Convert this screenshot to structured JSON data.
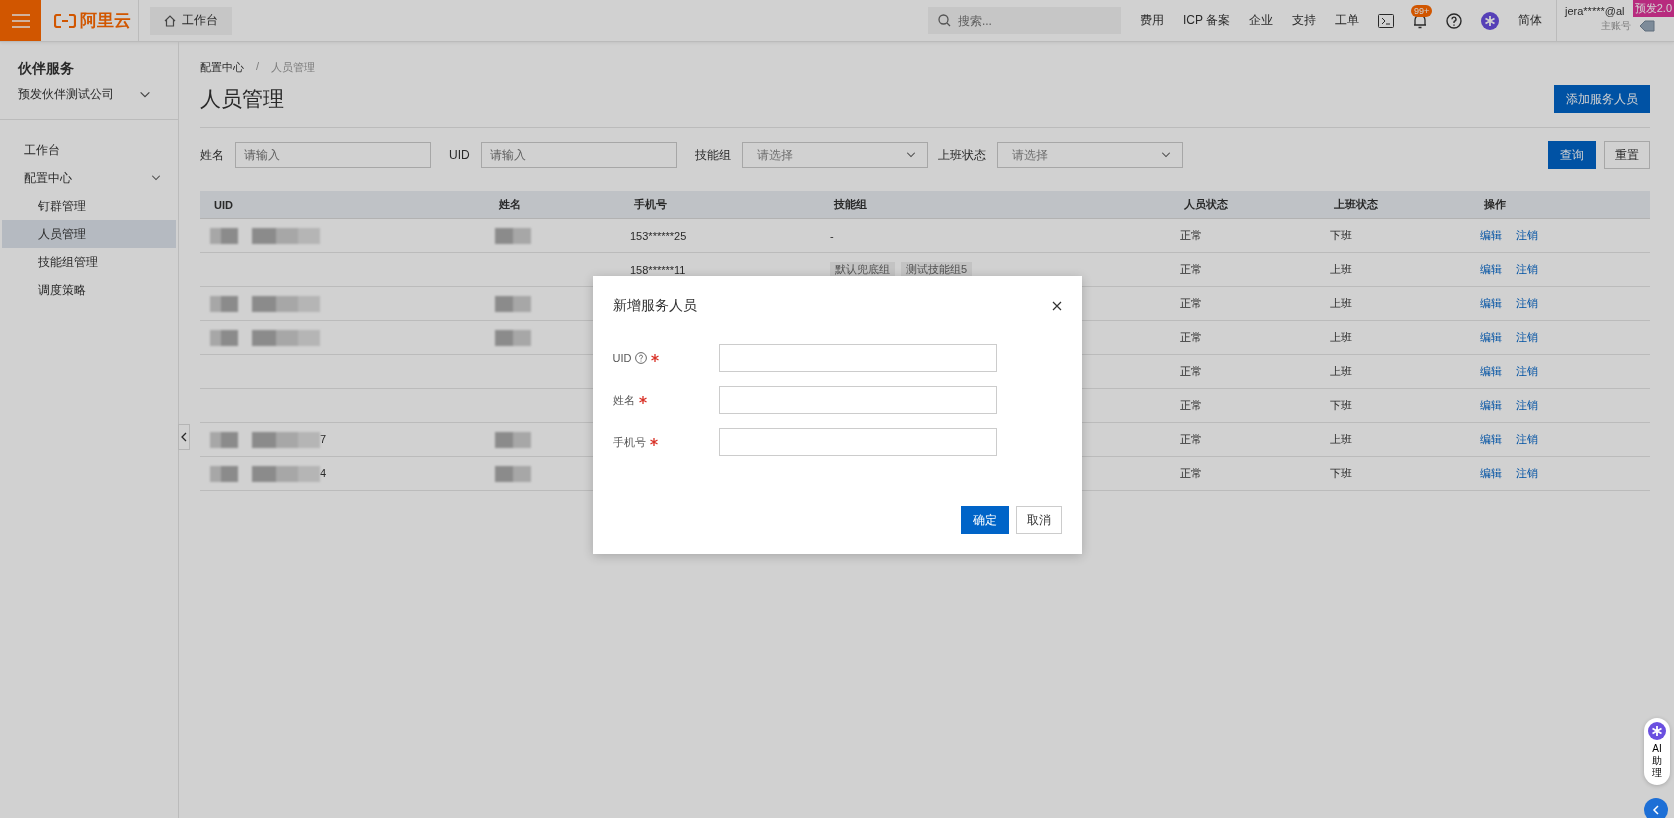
{
  "topbar": {
    "brand": "阿里云",
    "home_tab": "工作台",
    "search": {
      "placeholder": "搜索..."
    },
    "links": [
      "费用",
      "ICP 备案",
      "企业",
      "支持",
      "工单"
    ],
    "notification_badge": "99+",
    "language": "简体",
    "account": {
      "name": "jera*****@al",
      "role": "主账号"
    },
    "env_badge": "预发2.0"
  },
  "sidebar": {
    "title": "伙伴服务",
    "company": "预发伙伴测试公司",
    "items": [
      {
        "label": "工作台",
        "selected": false
      },
      {
        "label": "配置中心",
        "selected": false,
        "expanded": true,
        "children": [
          {
            "label": "钉群管理",
            "selected": false
          },
          {
            "label": "人员管理",
            "selected": true
          },
          {
            "label": "技能组管理",
            "selected": false
          },
          {
            "label": "调度策略",
            "selected": false
          }
        ]
      }
    ]
  },
  "breadcrumb": {
    "items": [
      "配置中心",
      "人员管理"
    ],
    "separator": "/"
  },
  "page_title": "人员管理",
  "add_button": "添加服务人员",
  "filters": [
    {
      "kind": "input",
      "label": "姓名",
      "placeholder": "请输入"
    },
    {
      "kind": "input",
      "label": "UID",
      "placeholder": "请输入"
    },
    {
      "kind": "select",
      "label": "技能组",
      "placeholder": "请选择"
    },
    {
      "kind": "select",
      "label": "上班状态",
      "placeholder": "请选择"
    }
  ],
  "query_button": "查询",
  "reset_button": "重置",
  "table": {
    "columns": [
      "UID",
      "姓名",
      "手机号",
      "技能组",
      "人员状态",
      "上班状态",
      "操作"
    ],
    "rows": [
      {
        "uid_redacted": true,
        "name_redacted": true,
        "phone": "153******25",
        "skills": "-",
        "skill_tags": [],
        "status": "正常",
        "shift": "下班",
        "actions": [
          "编辑",
          "注销"
        ]
      },
      {
        "uid_redacted": false,
        "name_redacted": false,
        "phone": "158******11",
        "skill_tags": [
          "默认兜底组",
          "测试技能组5"
        ],
        "status": "正常",
        "shift": "上班",
        "actions": [
          "编辑",
          "注销"
        ]
      },
      {
        "uid_redacted": true,
        "name_redacted": true,
        "skill_tags": [],
        "status": "正常",
        "shift": "上班",
        "actions": [
          "编辑",
          "注销"
        ]
      },
      {
        "uid_redacted": true,
        "name_redacted": true,
        "skill_tags": [],
        "status": "正常",
        "shift": "上班",
        "actions": [
          "编辑",
          "注销"
        ]
      },
      {
        "uid_redacted": false,
        "name_redacted": false,
        "skill_tags": [],
        "status": "正常",
        "shift": "上班",
        "actions": [
          "编辑",
          "注销"
        ]
      },
      {
        "uid_redacted": false,
        "name_redacted": false,
        "skill_tags": [],
        "status": "正常",
        "shift": "下班",
        "actions": [
          "编辑",
          "注销"
        ]
      },
      {
        "uid_redacted": true,
        "uid_tail": "7",
        "name_redacted": true,
        "skill_tags": [],
        "status": "正常",
        "shift": "上班",
        "actions": [
          "编辑",
          "注销"
        ]
      },
      {
        "uid_redacted": true,
        "uid_tail": "4",
        "name_redacted": true,
        "skill_tags": [],
        "status": "正常",
        "shift": "下班",
        "actions": [
          "编辑",
          "注销"
        ]
      }
    ]
  },
  "modal": {
    "title": "新增服务人员",
    "fields": [
      {
        "label": "UID",
        "help": true,
        "required": true
      },
      {
        "label": "姓名",
        "help": false,
        "required": true
      },
      {
        "label": "手机号",
        "help": false,
        "required": true
      }
    ],
    "confirm_button": "确定",
    "cancel_button": "取消"
  },
  "assistant": {
    "label": "AI助理"
  }
}
